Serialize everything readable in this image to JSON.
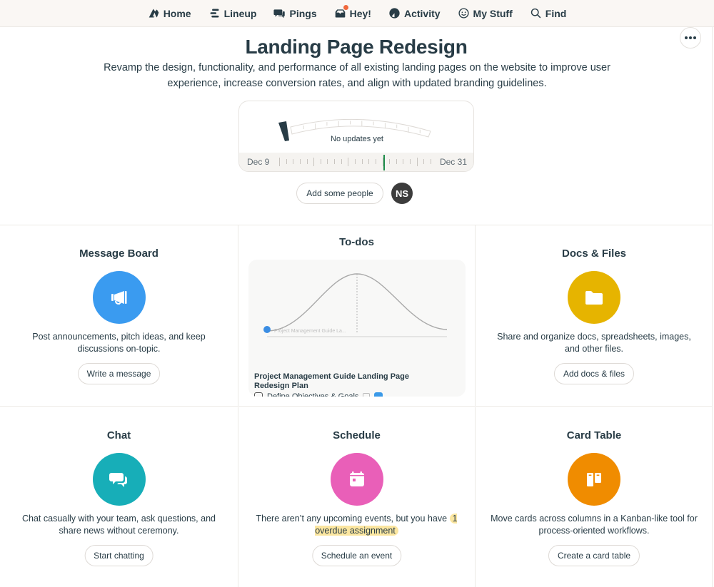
{
  "nav": {
    "items": [
      {
        "label": "Home",
        "icon": "basecamp-home-icon"
      },
      {
        "label": "Lineup",
        "icon": "lineup-icon"
      },
      {
        "label": "Pings",
        "icon": "pings-chat-icon"
      },
      {
        "label": "Hey!",
        "icon": "hey-inbox-icon",
        "has_badge": true
      },
      {
        "label": "Activity",
        "icon": "activity-icon"
      },
      {
        "label": "My Stuff",
        "icon": "smiley-icon"
      },
      {
        "label": "Find",
        "icon": "search-icon"
      }
    ],
    "badge_color": "#f0683c"
  },
  "project": {
    "title": "Landing Page Redesign",
    "description": "Revamp the design, functionality, and performance of all existing landing pages on the website to improve user experience, increase conversion rates, and align with updated branding guidelines.",
    "more_label": "More options"
  },
  "hill_chart": {
    "status_text": "No updates yet",
    "timeline_start": "Dec 9",
    "timeline_end": "Dec 31",
    "today_color": "#1e8c4a"
  },
  "people": {
    "add_label": "Add some people",
    "avatar_initials": "NS"
  },
  "tools": {
    "message_board": {
      "title": "Message Board",
      "description": "Post announcements, pitch ideas, and keep discussions on-topic.",
      "button": "Write a message",
      "color": "#3a9bf0"
    },
    "todos": {
      "title": "To-dos",
      "hill_label": "Project Management Guide La...",
      "list_name": "Project Management Guide Landing Page Redesign Plan",
      "first_item": "Define Objectives & Goals",
      "dot_color": "#3b8de3"
    },
    "docs": {
      "title": "Docs & Files",
      "description": "Share and organize docs, spreadsheets, images, and other files.",
      "button": "Add docs & files",
      "color": "#e6b400"
    },
    "chat": {
      "title": "Chat",
      "description": "Chat casually with your team, ask questions, and share news without ceremony.",
      "button": "Start chatting",
      "color": "#17aeb8"
    },
    "schedule": {
      "title": "Schedule",
      "description_prefix": "There aren’t any upcoming events, but you have ",
      "overdue_label": "1 overdue assignment",
      "button": "Schedule an event",
      "color": "#e95fb8"
    },
    "card_table": {
      "title": "Card Table",
      "description": "Move cards across columns in a Kanban-like tool for process-oriented workflows.",
      "button": "Create a card table",
      "color": "#f08c00"
    }
  }
}
